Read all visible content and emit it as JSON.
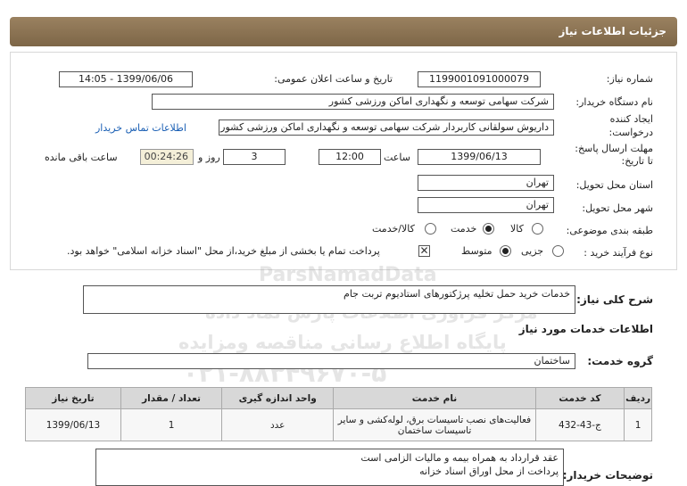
{
  "header": {
    "title": "جزئیات اطلاعات نیاز"
  },
  "form": {
    "need_number_label": "شماره نیاز:",
    "need_number": "1199001091000079",
    "announce_label": "تاریخ و ساعت اعلان عمومی:",
    "announce_value": "1399/06/06 - 14:05",
    "buyer_label": "نام دستگاه خریدار:",
    "buyer_value": "شرکت سهامی توسعه و نگهداری اماکن ورزشی کشور",
    "creator_label_1": "ایجاد کننده",
    "creator_label_2": "درخواست:",
    "creator_value": "داریوش سولقانی کاربردار شرکت سهامی توسعه و نگهداری اماکن ورزشی کشور",
    "contact_link": "اطلاعات تماس خریدار",
    "deadline_label_1": "مهلت ارسال پاسخ:",
    "deadline_label_2": "تا تاریخ:",
    "deadline_date": "1399/06/13",
    "time_label": "ساعت",
    "deadline_time": "12:00",
    "days_value": "3",
    "days_label": "روز و",
    "remaining_time": "00:24:26",
    "remaining_label": "ساعت باقی مانده",
    "province_label": "استان محل تحویل:",
    "province_value": "تهران",
    "city_label": "شهر محل تحویل:",
    "city_value": "تهران",
    "category_label": "طبقه بندی موضوعی:",
    "category_options": [
      "کالا",
      "خدمت",
      "کالا/خدمت"
    ],
    "category_selected": "خدمت",
    "process_label": "نوع فرآیند خرید :",
    "process_options": [
      "جزیی",
      "متوسط"
    ],
    "process_selected": "متوسط",
    "payment_note": "پرداخت تمام یا بخشی از مبلغ خرید،از محل \"اسناد خزانه اسلامی\" خواهد بود."
  },
  "description": {
    "label": "شرح کلی نیاز:",
    "value": "خدمات خرید حمل تخلیه پرژکتورهای استادیوم تربت جام"
  },
  "services": {
    "section_title": "اطلاعات خدمات مورد نیاز",
    "group_label": "گروه خدمت:",
    "group_value": "ساختمان",
    "columns": [
      "ردیف",
      "کد خدمت",
      "نام خدمت",
      "واحد اندازه گیری",
      "تعداد / مقدار",
      "تاریخ نیاز"
    ],
    "rows": [
      {
        "index": "1",
        "code": "ج-43-432",
        "name_line1": "فعالیت‌های نصب تاسیسات برق، لوله‌کشی و سایر",
        "name_line2": "تاسیسات ساختمان",
        "unit": "عدد",
        "qty": "1",
        "date": "1399/06/13"
      }
    ]
  },
  "notes": {
    "label": "توضیحات خریدار:",
    "line1": "عقد قرارداد به همراه بیمه و مالیات الزامی است",
    "line2": "پرداخت از محل اوراق اسناد خزانه"
  },
  "watermark": {
    "brand": "ParsNamadData",
    "line1": "مرکز فراوری اطلاعات پارس نماد داده",
    "line2": "پایگاه اطلاع رسانی مناقصه ومزایده",
    "phone": "۰۲۱-۸۸۳۴۹۶۷۰-۵"
  },
  "colors": {
    "header_bg": "#8b7355",
    "link": "#1a5fb4",
    "timer_bg": "#f4efd8"
  }
}
